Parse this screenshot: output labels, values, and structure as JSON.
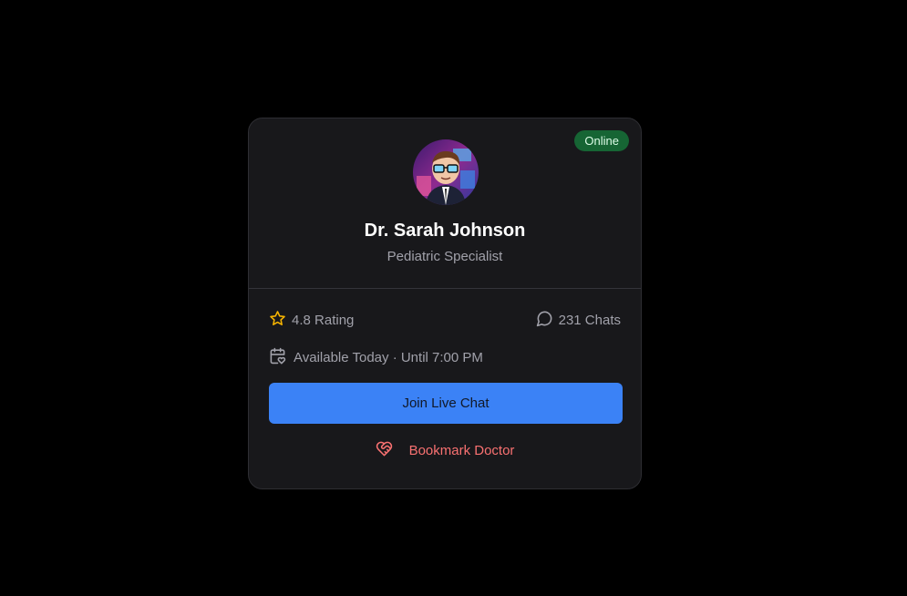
{
  "doctor": {
    "status": "Online",
    "name": "Dr. Sarah Johnson",
    "specialty": "Pediatric Specialist"
  },
  "stats": {
    "rating": "4.8 Rating",
    "chats": "231 Chats"
  },
  "availability": "Available Today · Until 7:00 PM",
  "actions": {
    "join_label": "Join Live Chat",
    "bookmark_label": "Bookmark Doctor"
  },
  "icons": {
    "rating": "star-icon",
    "chats": "chat-bubble-icon",
    "availability": "calendar-heart-icon",
    "bookmark": "heart-handshake-icon"
  },
  "colors": {
    "background": "#000000",
    "card": "#18181b",
    "status_badge": "#166534",
    "accent": "#3b82f6",
    "star": "#f5b301",
    "bookmark": "#f87171"
  }
}
